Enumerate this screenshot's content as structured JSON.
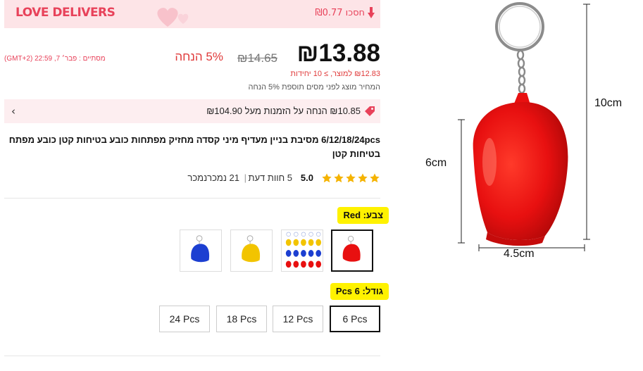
{
  "banner": {
    "brand": "LOVE DELIVERS",
    "save_text": "חסכו ₪0.77"
  },
  "price": {
    "current": "₪13.88",
    "original": "₪14.65",
    "discount": "5% הנחה",
    "timer": "מסתיים : פבר׳ 7, 22:59 (GMT+2)",
    "unit_price": "₪12.83 למוצר, ≥ 10 יחידות",
    "tax_note": "המחיר מוצג לפני מסים תוספת 5% הנחה"
  },
  "coupon": {
    "text": "₪10.85 הנחה על הזמנות מעל ₪104.90"
  },
  "product": {
    "title": "6/12/18/24pcs מסיבת בניין מעדיף מיני קסדה מחזיק מפתחות כובע בטיחות קטן כובע מפתח בטיחות קטן",
    "rating": "5.0",
    "reviews": "5 חוות דעת",
    "sold": "21 נמכרנמכר",
    "rating_stars": 5
  },
  "color": {
    "label": "צבע: Red",
    "options": [
      "Red",
      "Mixed",
      "Yellow",
      "Blue"
    ],
    "selected": "Red"
  },
  "size": {
    "label": "גודל: 6 Pcs",
    "options": [
      "6 Pcs",
      "12 Pcs",
      "18 Pcs",
      "24 Pcs"
    ],
    "selected": "6 Pcs"
  },
  "dimensions": {
    "height": "10cm",
    "depth": "6cm",
    "width": "4.5cm"
  },
  "colors": {
    "accent": "#e8425a",
    "price_red": "#e03a3a",
    "highlight": "#fff200",
    "helmet_red": "#e81010"
  }
}
